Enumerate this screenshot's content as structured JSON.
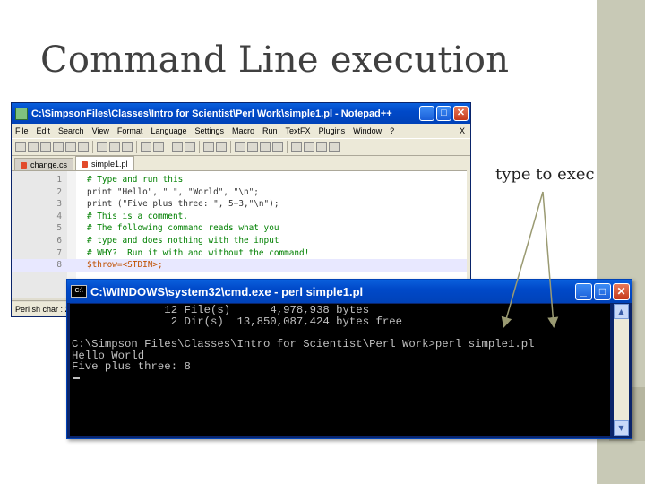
{
  "slide": {
    "title": "Command Line execution",
    "callout": "type to exec"
  },
  "notepad": {
    "title": "C:\\SimpsonFiles\\Classes\\Intro for Scientist\\Perl Work\\simple1.pl - Notepad++",
    "window_buttons": {
      "minimize": "_",
      "maximize": "□",
      "close": "✕"
    },
    "menu": [
      "File",
      "Edit",
      "Search",
      "View",
      "Format",
      "Language",
      "Settings",
      "Macro",
      "Run",
      "TextFX",
      "Plugins",
      "Window",
      "?"
    ],
    "menu_close": "X",
    "tabs": [
      {
        "label": "change.cs",
        "active": false
      },
      {
        "label": "simple1.pl",
        "active": true
      }
    ],
    "lines": [
      {
        "num": "1",
        "text": "# Type and run this"
      },
      {
        "num": "2",
        "text": "print \"Hello\", \" \", \"World\", \"\\n\";"
      },
      {
        "num": "3",
        "text": "print (\"Five plus three: \", 5+3,\"\\n\");"
      },
      {
        "num": "4",
        "text": "# This is a comment."
      },
      {
        "num": "5",
        "text": "# The following command reads what you"
      },
      {
        "num": "6",
        "text": "# type and does nothing with the input"
      },
      {
        "num": "7",
        "text": "# WHY?  Run it with and without the command!"
      },
      {
        "num": "8",
        "text": "$throw=<STDIN>;"
      }
    ],
    "status": "Perl sh char : 2"
  },
  "cmd": {
    "icon_label": "C:\\",
    "title": "C:\\WINDOWS\\system32\\cmd.exe - perl simple1.pl",
    "window_buttons": {
      "minimize": "_",
      "maximize": "□",
      "close": "✕"
    },
    "lines": [
      "              12 File(s)      4,978,938 bytes",
      "               2 Dir(s)  13,850,087,424 bytes free",
      "",
      "C:\\Simpson Files\\Classes\\Intro for Scientist\\Perl Work>perl simple1.pl",
      "Hello World",
      "Five plus three: 8"
    ],
    "scroll_up": "▲",
    "scroll_down": "▼"
  }
}
